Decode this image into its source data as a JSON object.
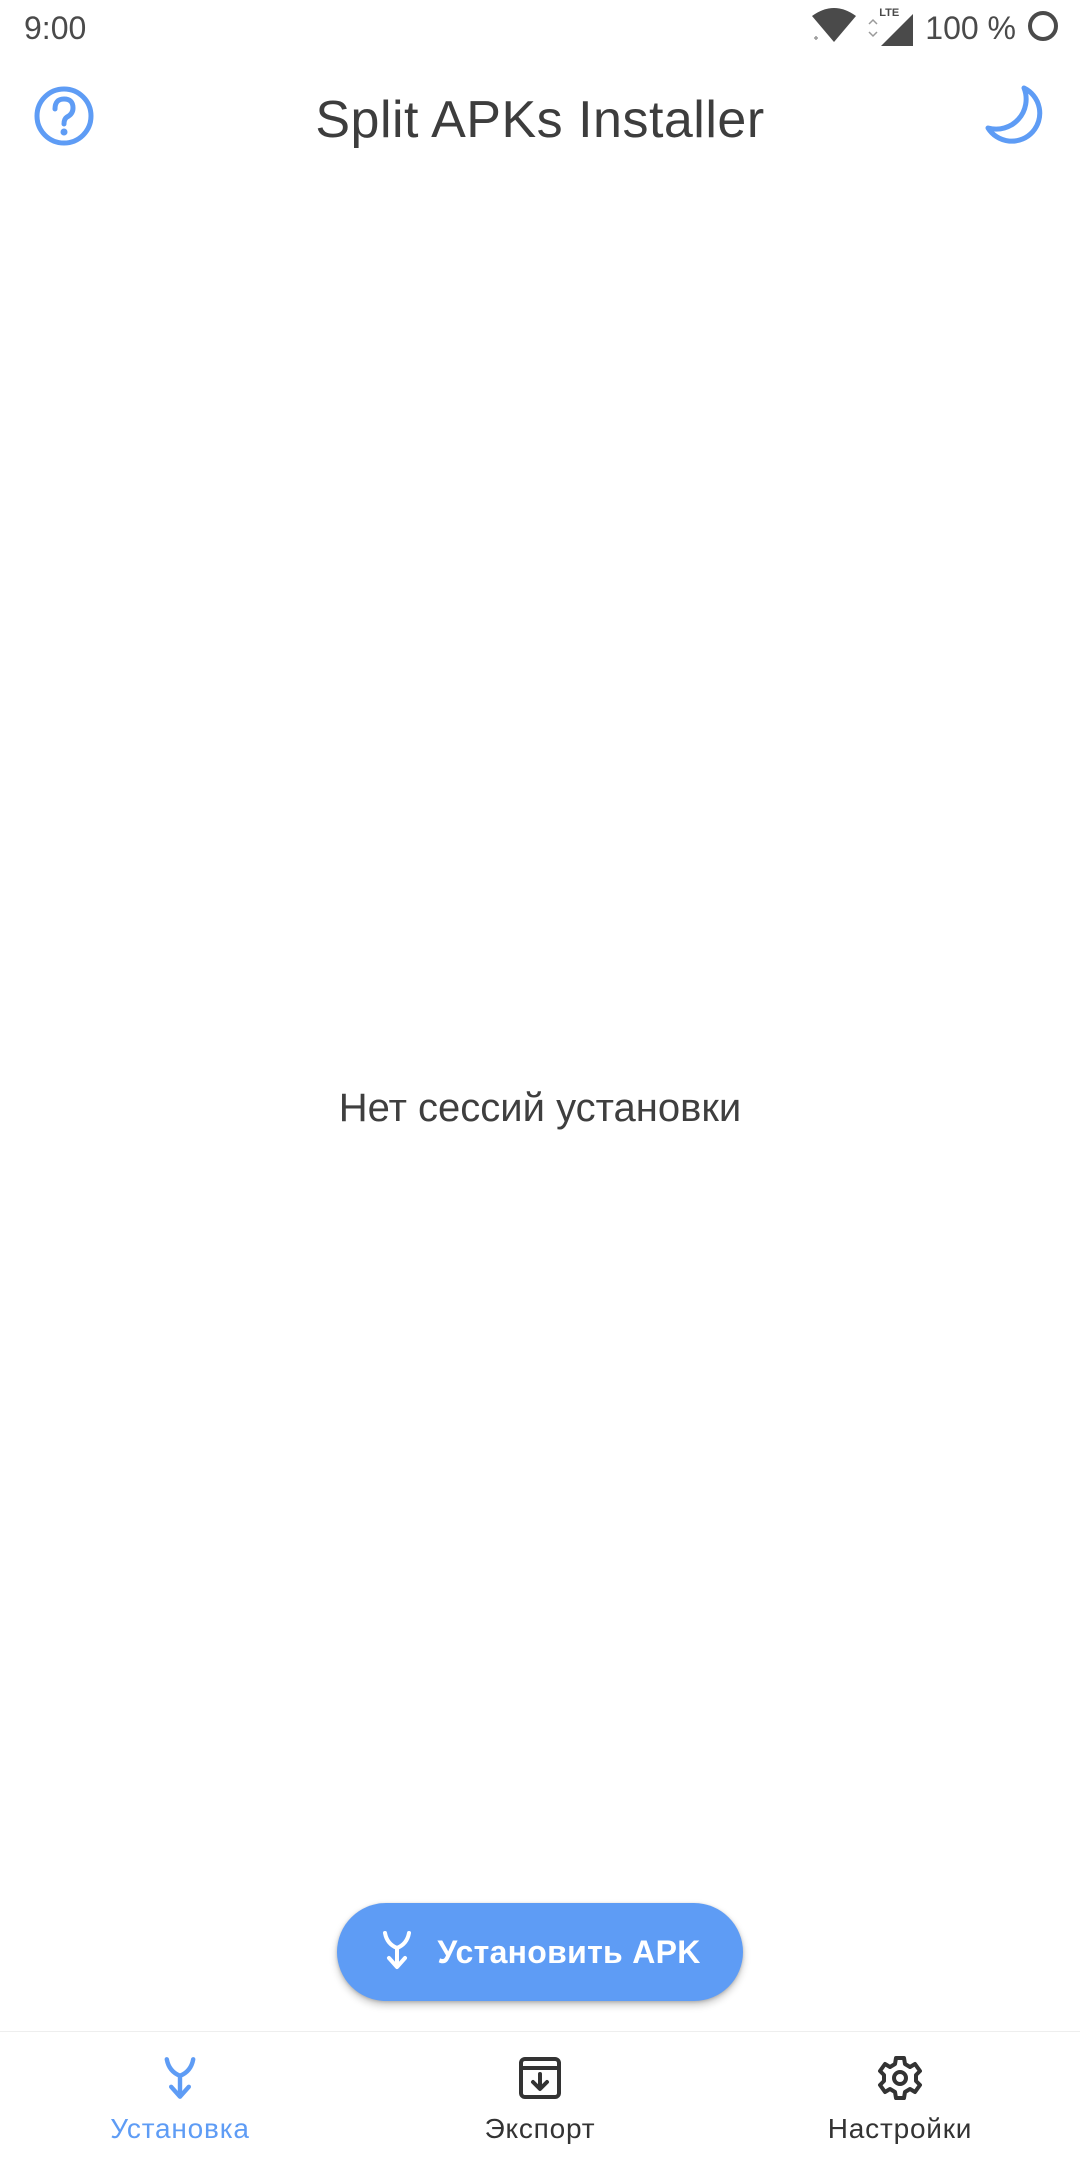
{
  "status_bar": {
    "time": "9:00",
    "network": "LTE",
    "battery": "100 %"
  },
  "app_bar": {
    "title": "Split APKs Installer",
    "left_icon": "help-circle-icon",
    "right_icon": "moon-icon"
  },
  "empty_state": {
    "message": "Нет сессий установки"
  },
  "fab": {
    "label": "Установить APK",
    "icon": "merge-arrow-icon"
  },
  "bottom_nav": {
    "items": [
      {
        "label": "Установка",
        "icon": "merge-arrow-icon",
        "active": true
      },
      {
        "label": "Экспорт",
        "icon": "archive-download-icon",
        "active": false
      },
      {
        "label": "Настройки",
        "icon": "gear-icon",
        "active": false
      }
    ]
  },
  "colors": {
    "accent": "#5e9cf5",
    "text_primary": "#3d3d3d",
    "nav_inactive": "#333333",
    "background": "#ffffff"
  }
}
